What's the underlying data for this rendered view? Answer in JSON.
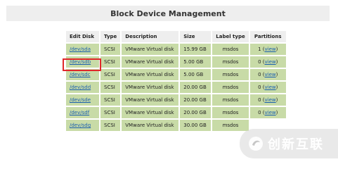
{
  "page_title": "Block Device Management",
  "table": {
    "headers": {
      "edit_disk": "Edit Disk",
      "type": "Type",
      "description": "Description",
      "size": "Size",
      "label_type": "Label type",
      "partitions": "Partitions"
    },
    "rows": [
      {
        "device": "/dev/sda",
        "type": "SCSI",
        "description": "VMware Virtual disk",
        "size": "15.99 GB",
        "label_type": "msdos",
        "partitions_count": "1",
        "view_label": "view"
      },
      {
        "device": "/dev/sdb",
        "type": "SCSI",
        "description": "VMware Virtual disk",
        "size": "5.00 GB",
        "label_type": "msdos",
        "partitions_count": "0",
        "view_label": "view"
      },
      {
        "device": "/dev/sdc",
        "type": "SCSI",
        "description": "VMware Virtual disk",
        "size": "5.00 GB",
        "label_type": "msdos",
        "partitions_count": "0",
        "view_label": "view"
      },
      {
        "device": "/dev/sdd",
        "type": "SCSI",
        "description": "VMware Virtual disk",
        "size": "20.00 GB",
        "label_type": "msdos",
        "partitions_count": "0",
        "view_label": "view"
      },
      {
        "device": "/dev/sde",
        "type": "SCSI",
        "description": "VMware Virtual disk",
        "size": "20.00 GB",
        "label_type": "msdos",
        "partitions_count": "0",
        "view_label": "view"
      },
      {
        "device": "/dev/sdf",
        "type": "SCSI",
        "description": "VMware Virtual disk",
        "size": "20.00 GB",
        "label_type": "msdos",
        "partitions_count": "0",
        "view_label": "view"
      },
      {
        "device": "/dev/sdg",
        "type": "SCSI",
        "description": "VMware Virtual disk",
        "size": "30.00 GB",
        "label_type": "msdos",
        "partitions_count": "",
        "view_label": ""
      }
    ]
  },
  "watermark": {
    "text": "创新互联",
    "icon": "brand-logo-icon"
  },
  "colors": {
    "row_bg": "#c8dba7",
    "header_bg": "#eeeeee",
    "link": "#1a5fae",
    "highlight": "#e0282a"
  }
}
